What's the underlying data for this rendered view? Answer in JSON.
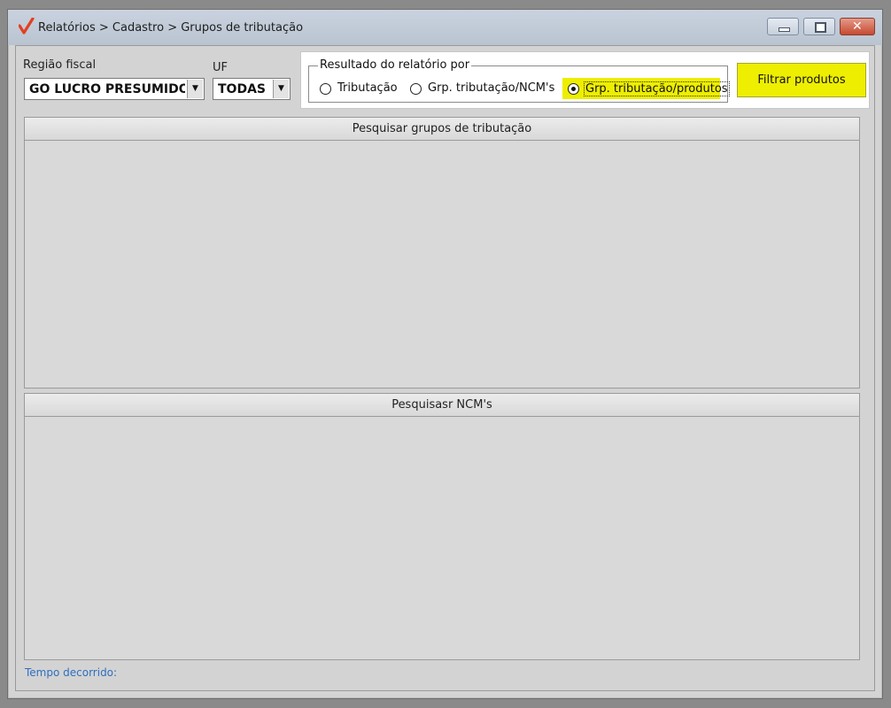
{
  "window": {
    "title": "Relatórios > Cadastro > Grupos de tributação"
  },
  "filters": {
    "regiao_fiscal_label": "Região fiscal",
    "regiao_fiscal_value": "GO LUCRO PRESUMIDO",
    "uf_label": "UF",
    "uf_value": "TODAS"
  },
  "result_by": {
    "group_title": "Resultado do relatório por",
    "options": [
      {
        "label": "Tributação",
        "selected": false
      },
      {
        "label": "Grp. tributação/NCM's",
        "selected": false
      },
      {
        "label": "Grp. tributação/produtos",
        "selected": true
      }
    ],
    "highlight_color": "#eeee00"
  },
  "actions": {
    "filter_label": "Filtrar produtos"
  },
  "panes": {
    "grupos_header": "Pesquisar grupos de tributação",
    "ncm_header": "Pesquisasr NCM's"
  },
  "status": {
    "elapsed_label": "Tempo decorrido:"
  }
}
